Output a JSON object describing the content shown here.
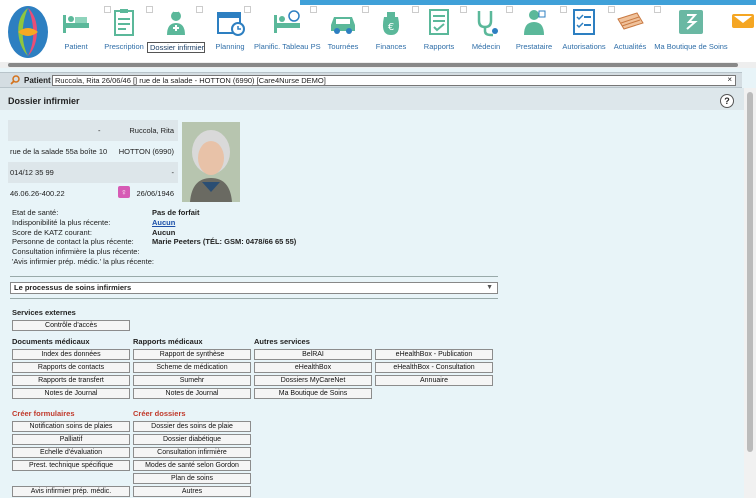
{
  "nav": [
    {
      "key": "patient",
      "label": "Patient",
      "icon": "patient-bed-icon"
    },
    {
      "key": "prescription",
      "label": "Prescription",
      "icon": "clipboard-icon"
    },
    {
      "key": "dossier",
      "label": "Dossier infirmier",
      "icon": "nurse-icon",
      "active": true
    },
    {
      "key": "planning",
      "label": "Planning",
      "icon": "calendar-icon"
    },
    {
      "key": "planif",
      "label": "Planific. Tableau PS",
      "icon": "bed-schedule-icon"
    },
    {
      "key": "tournees",
      "label": "Tournées",
      "icon": "car-icon"
    },
    {
      "key": "finances",
      "label": "Finances",
      "icon": "euro-bag-icon"
    },
    {
      "key": "rapports",
      "label": "Rapports",
      "icon": "report-icon"
    },
    {
      "key": "medecin",
      "label": "Médecin",
      "icon": "stethoscope-icon"
    },
    {
      "key": "prestataire",
      "label": "Prestataire",
      "icon": "doctor-icon"
    },
    {
      "key": "autorisations",
      "label": "Autorisations",
      "icon": "checklist-icon"
    },
    {
      "key": "actualites",
      "label": "Actualités",
      "icon": "newspaper-icon"
    },
    {
      "key": "boutique",
      "label": "Ma Boutique de Soins",
      "icon": "shop-icon"
    }
  ],
  "patient_bar": {
    "label": "Patient",
    "value": "Ruccola, Rita 26/06/46 [] rue de la salade - HOTTON (6990) [Care4Nurse DEMO]",
    "clear": "×"
  },
  "page": {
    "title": "Dossier infirmier",
    "help": "?"
  },
  "card": {
    "r1": {
      "left": "-",
      "right": "Ruccola, Rita"
    },
    "r2": {
      "left": "rue de la salade 55a boîte 10",
      "right": "HOTTON (6990)"
    },
    "r3": {
      "left": "014/12 35 99",
      "right": "-"
    },
    "r4": {
      "left": "46.06.26-400.22",
      "right": "26/06/1946"
    }
  },
  "info": [
    {
      "k": "Etat de santé:",
      "v": "Pas de forfait"
    },
    {
      "k": "Indisponibilité la plus récente:",
      "v": "Aucun",
      "link": true
    },
    {
      "k": "Score de KATZ courant:",
      "v": "Aucun"
    },
    {
      "k": "Personne de contact la plus récente:",
      "v": "Marie Peeters (TÉL: GSM: 0478/66 65 55)"
    },
    {
      "k": "Consultation infirmière la plus récente:",
      "v": ""
    },
    {
      "k": "'Avis infirmier prép. médic.' la plus récente:",
      "v": ""
    }
  ],
  "process_dropdown": "Le processus de soins infirmiers",
  "sections": {
    "services_externes": "Services externes",
    "documents_medicaux": "Documents médicaux",
    "rapports_medicaux": "Rapports médicaux",
    "autres_services": "Autres services",
    "creer_formulaires": "Créer formulaires",
    "creer_dossiers": "Créer dossiers"
  },
  "buttons": {
    "controle_acces": "Contrôle d'accès",
    "index_donnees": "Index des données",
    "rapports_contacts": "Rapports de contacts",
    "rapports_transfert": "Rapports de transfert",
    "notes_journal_1": "Notes de Journal",
    "rapport_synthese": "Rapport de synthèse",
    "scheme_medication": "Scheme de médication",
    "sumehr": "Sumehr",
    "notes_journal_2": "Notes de Journal",
    "belrai": "BelRAI",
    "ehealthbox": "eHealthBox",
    "dossiers_mycarenet": "Dossiers MyCareNet",
    "ma_boutique": "Ma Boutique de Soins",
    "ehb_publication": "eHealthBox - Publication",
    "ehb_consultation": "eHealthBox - Consultation",
    "annuaire": "Annuaire",
    "notif_plaies": "Notification soins de plaies",
    "palliatif": "Palliatif",
    "echelle_eval": "Echelle d'évaluation",
    "prest_technique": "Prest. technique spécifique",
    "avis_infirmier": "Avis infirmier prép. médic.",
    "dossier_plaie": "Dossier des soins de plaie",
    "dossier_diabetique": "Dossier diabétique",
    "consultation_inf": "Consultation infirmière",
    "modes_gordon": "Modes de santé selon Gordon",
    "plan_soins": "Plan de soins",
    "autres": "Autres"
  },
  "colors": {
    "nav_label": "#2f6ea8",
    "icon_green": "#5bb89a",
    "accent_blue": "#3fa0d8",
    "female": "#d65bb5"
  }
}
